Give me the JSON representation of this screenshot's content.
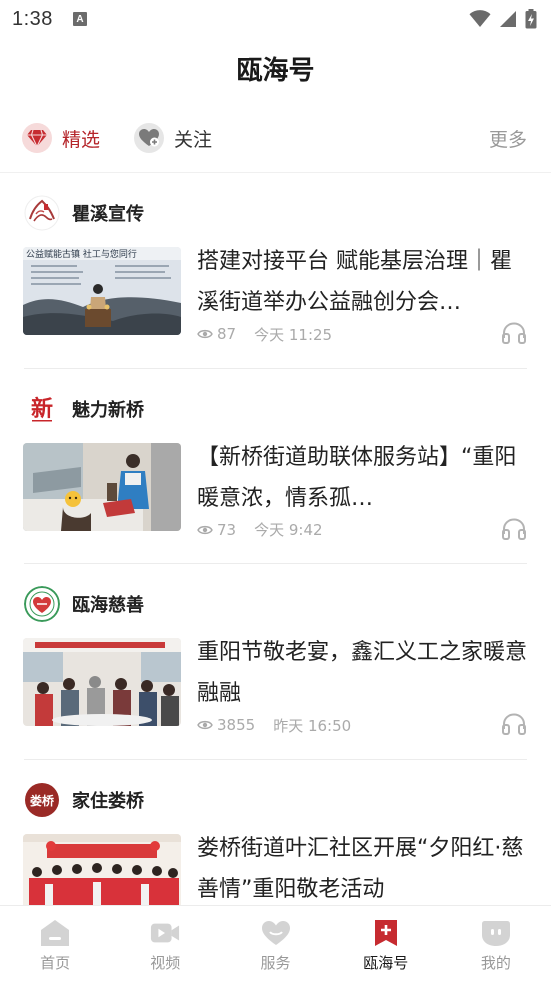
{
  "status_bar": {
    "time": "1:38",
    "notification_letter": "A"
  },
  "header": {
    "title": "瓯海号"
  },
  "tabs": {
    "featured": {
      "label": "精选",
      "icon": "diamond-icon"
    },
    "follow": {
      "label": "关注",
      "icon": "heart-plus-icon"
    },
    "more_label": "更多"
  },
  "feed": [
    {
      "source": "瞿溪宣传",
      "title": "搭建对接平台 赋能基层治理｜瞿溪街道举办公益融创分会…",
      "views": "87",
      "time": "今天 11:25",
      "thumb_caption": "公益赋能古镇 社工与您同行"
    },
    {
      "source": "魅力新桥",
      "title": "【新桥街道助联体服务站】“重阳暖意浓，情系孤…",
      "views": "73",
      "time": "今天 9:42",
      "logo_text": "新"
    },
    {
      "source": "瓯海慈善",
      "title": "重阳节敬老宴，鑫汇义工之家暖意融融",
      "views": "3855",
      "time": "昨天 16:50"
    },
    {
      "source": "家住娄桥",
      "title": "娄桥街道叶汇社区开展“夕阳红·慈善情”重阳敬老活动",
      "views": "",
      "time": "",
      "logo_text": "娄桥"
    }
  ],
  "bottom_nav": [
    {
      "label": "首页",
      "icon": "home-icon"
    },
    {
      "label": "视频",
      "icon": "video-icon"
    },
    {
      "label": "服务",
      "icon": "heart-icon"
    },
    {
      "label": "瓯海号",
      "icon": "bookmark-plus-icon",
      "active": true
    },
    {
      "label": "我的",
      "icon": "profile-icon"
    }
  ],
  "colors": {
    "accent": "#b5252a",
    "muted": "#999999",
    "nav_inactive": "#c8c8c8"
  }
}
